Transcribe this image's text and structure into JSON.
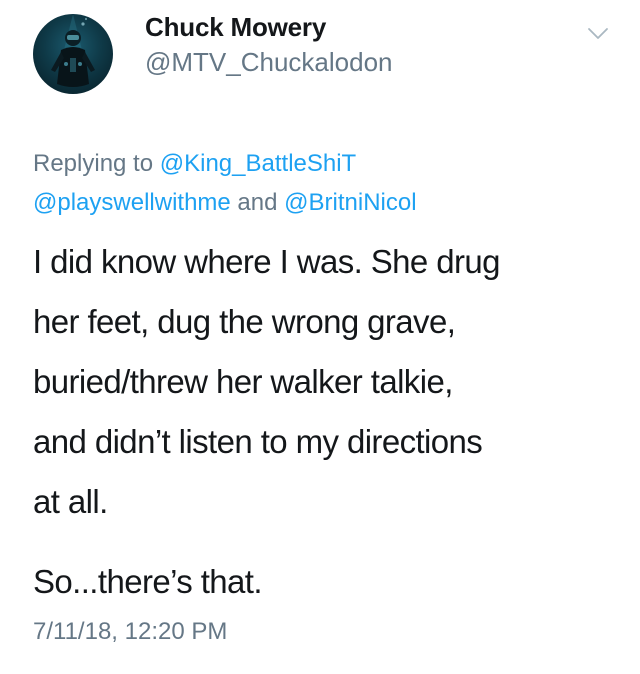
{
  "author": {
    "display_name": "Chuck Mowery",
    "handle": "@MTV_Chuckalodon",
    "avatar_icon": "scuba-diver-avatar"
  },
  "menu_icon": "chevron-down-icon",
  "reply": {
    "prefix": "Replying to ",
    "mention_1": "@King_BattleShiT",
    "mention_2": "@playswellwithme",
    "conjunction": " and ",
    "mention_3": "@BritniNicol"
  },
  "text": {
    "paragraph_1_lines": [
      "I did know where I was. She drug",
      "her feet, dug the wrong grave,",
      "buried/threw her walker talkie,",
      "and didn’t listen to my directions",
      "at all."
    ],
    "paragraph_2": "So...there’s that."
  },
  "timestamp": "7/11/18, 12:20 PM",
  "colors": {
    "text": "#14171a",
    "secondary": "#657786",
    "link": "#1da1f2"
  }
}
